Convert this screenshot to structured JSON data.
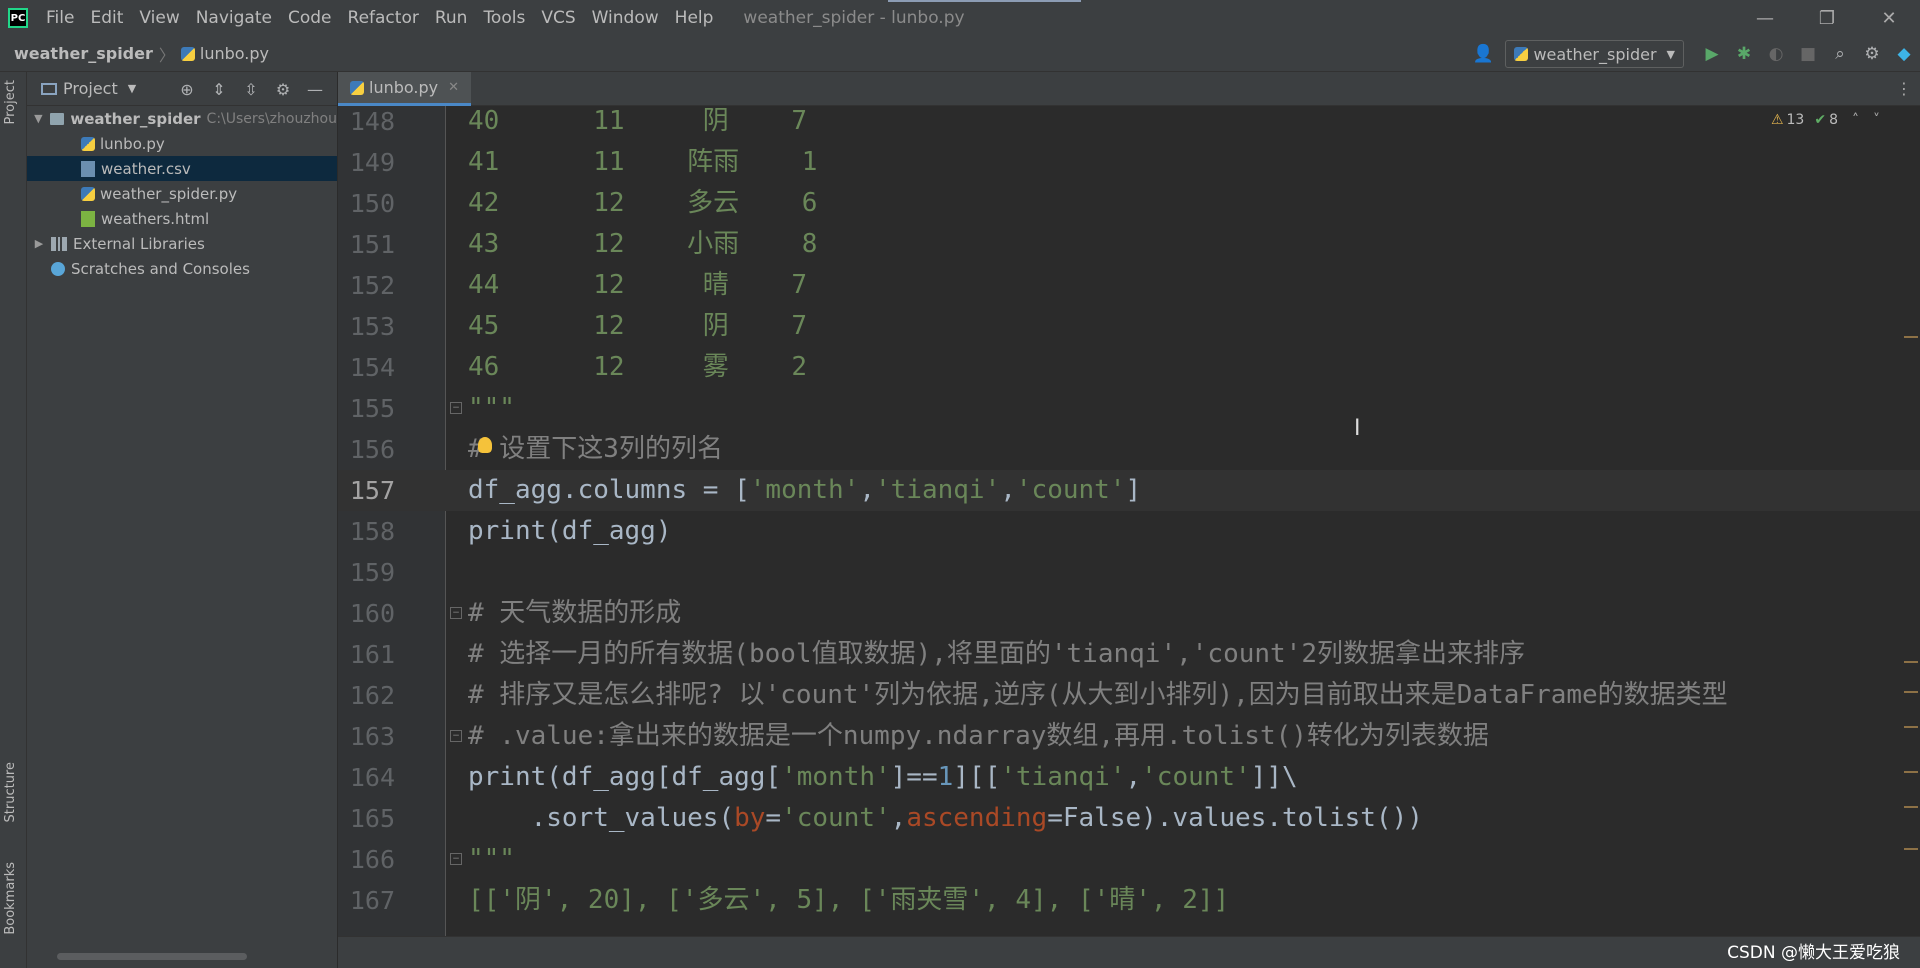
{
  "menu": [
    "File",
    "Edit",
    "View",
    "Navigate",
    "Code",
    "Refactor",
    "Run",
    "Tools",
    "VCS",
    "Window",
    "Help"
  ],
  "window_title": "weather_spider - lunbo.py",
  "app_logo": "PC",
  "breadcrumb": {
    "project": "weather_spider",
    "file": "lunbo.py"
  },
  "run_config": "weather_spider",
  "left_strip": {
    "project": "Project",
    "structure": "Structure",
    "bookmarks": "Bookmarks"
  },
  "project_panel": {
    "title": "Project",
    "tree": [
      {
        "label": "weather_spider",
        "path": "C:\\Users\\zhouzhou"
      },
      {
        "label": "lunbo.py"
      },
      {
        "label": "weather.csv"
      },
      {
        "label": "weather_spider.py"
      },
      {
        "label": "weathers.html"
      },
      {
        "label": "External Libraries"
      },
      {
        "label": "Scratches and Consoles"
      }
    ]
  },
  "editor_tab": "lunbo.py",
  "inspection": {
    "warnings": "13",
    "weak": "8"
  },
  "code_lines": [
    {
      "num": "148",
      "text": "40      11     阴    7"
    },
    {
      "num": "149",
      "text": "41      11    阵雨    1"
    },
    {
      "num": "150",
      "text": "42      12    多云    6"
    },
    {
      "num": "151",
      "text": "43      12    小雨    8"
    },
    {
      "num": "152",
      "text": "44      12     晴    7"
    },
    {
      "num": "153",
      "text": "45      12     阴    7"
    },
    {
      "num": "154",
      "text": "46      12     雾    2"
    },
    {
      "num": "155",
      "text": "\"\"\""
    },
    {
      "num": "156",
      "text": "# 设置下这3列的列名"
    },
    {
      "num": "157",
      "a": "df_agg.columns = [",
      "b": "'month'",
      "c": ",",
      "d": "'tianqi'",
      "e": ",",
      "f": "'count'",
      "g": "]"
    },
    {
      "num": "158",
      "text": "print(df_agg)"
    },
    {
      "num": "159",
      "text": ""
    },
    {
      "num": "160",
      "text": "# 天气数据的形成"
    },
    {
      "num": "161",
      "text": "# 选择一月的所有数据(bool值取数据),将里面的'tianqi','count'2列数据拿出来排序"
    },
    {
      "num": "162",
      "text": "# 排序又是怎么排呢? 以'count'列为依据,逆序(从大到小排列),因为目前取出来是DataFrame的数据类型"
    },
    {
      "num": "163",
      "text": "# .value:拿出来的数据是一个numpy.ndarray数组,再用.tolist()转化为列表数据"
    },
    {
      "num": "164",
      "a": "print(df_agg[df_agg[",
      "b": "'month'",
      "c": "]==",
      "d": "1",
      "e": "][[",
      "f": "'tianqi'",
      "g": ",",
      "h": "'count'",
      "i": "]]\\"
    },
    {
      "num": "165",
      "a": "    .sort_values(",
      "b": "by",
      "c": "=",
      "d": "'count'",
      "e": ",",
      "f": "ascending",
      "g": "=False).values.tolist())"
    },
    {
      "num": "166",
      "text": "\"\"\""
    },
    {
      "num": "167",
      "text": "[['阴', 20], ['多云', 5], ['雨夹雪', 4], ['晴', 2]]"
    }
  ],
  "watermark": "CSDN @懒大王爱吃狼",
  "colors": {
    "bg": "#2b2b2b",
    "panel": "#3c3f41",
    "string": "#6a8759",
    "comment": "#808080",
    "number": "#6897bb",
    "keyword_arg": "#aa4926",
    "selection": "#0d293e"
  }
}
